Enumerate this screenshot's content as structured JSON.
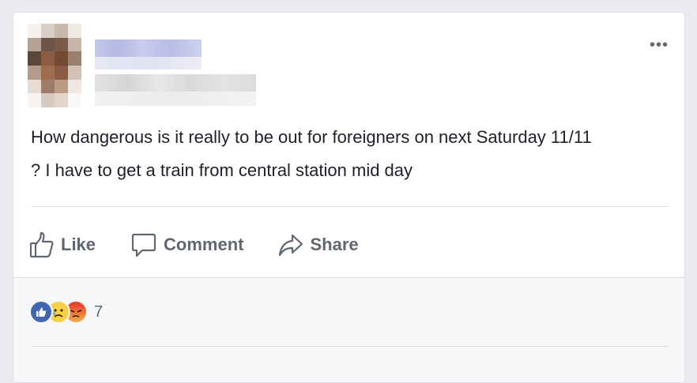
{
  "post": {
    "text_line1": "How dangerous is it really to be out for foreigners on next Saturday 11/11",
    "text_line2": "? I have to get a train from central station mid day"
  },
  "menu": {
    "more_label": "•••"
  },
  "actions": {
    "like_label": "Like",
    "comment_label": "Comment",
    "share_label": "Share"
  },
  "reactions": {
    "types": [
      "like-icon",
      "sad-icon",
      "angry-icon"
    ],
    "count": "7"
  },
  "colors": {
    "like_blue": "#4267b2",
    "text": "#1d2129",
    "muted": "#606770",
    "sad_yellow": "#f7d046",
    "angry_orange": "#f0653a"
  }
}
